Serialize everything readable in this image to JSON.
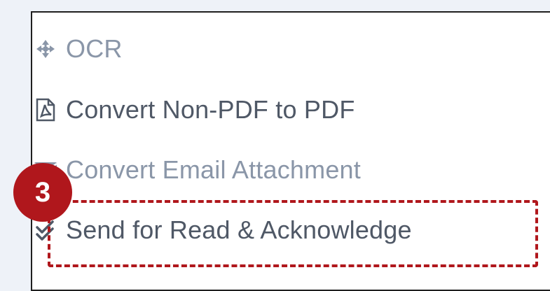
{
  "menu": {
    "items": [
      {
        "label": "OCR",
        "icon": "crosshair-arrows-icon",
        "state": "disabled"
      },
      {
        "label": "Convert Non-PDF to PDF",
        "icon": "pdf-file-icon",
        "state": "enabled"
      },
      {
        "label": "Convert Email Attachment",
        "icon": "envelope-icon",
        "state": "disabled"
      },
      {
        "label": "Send for Read & Acknowledge",
        "icon": "double-check-icon",
        "state": "enabled"
      }
    ]
  },
  "annotation": {
    "step_number": "3",
    "highlight_color": "#b0171c"
  },
  "colors": {
    "background": "#eef2f8",
    "enabled_text": "#4f5866",
    "disabled_text": "#8a96a8",
    "accent_red": "#b0171c"
  }
}
